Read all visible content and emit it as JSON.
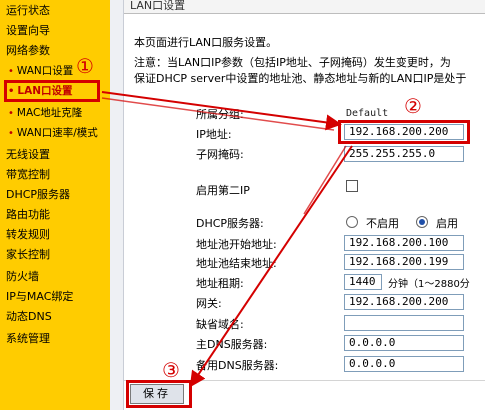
{
  "sidebar": {
    "items": [
      {
        "label": "运行状态"
      },
      {
        "label": "设置向导"
      },
      {
        "label": "网络参数"
      },
      {
        "label": "WAN口设置"
      },
      {
        "label": "LAN口设置"
      },
      {
        "label": "MAC地址克隆"
      },
      {
        "label": "WAN口速率/模式"
      },
      {
        "label": "无线设置"
      },
      {
        "label": "带宽控制"
      },
      {
        "label": "DHCP服务器"
      },
      {
        "label": "路由功能"
      },
      {
        "label": "转发规则"
      },
      {
        "label": "家长控制"
      },
      {
        "label": "防火墙"
      },
      {
        "label": "IP与MAC绑定"
      },
      {
        "label": "动态DNS"
      },
      {
        "label": "系统管理"
      }
    ]
  },
  "panel": {
    "title": "LAN口设置",
    "desc1": "本页面进行LAN口服务设置。",
    "desc2": "注意：当LAN口IP参数（包括IP地址、子网掩码）发生变更时，为",
    "desc3": "保证DHCP server中设置的地址池、静态地址与新的LAN口IP是处于"
  },
  "form": {
    "group_label": "所属分组:",
    "group_value": "Default",
    "ip_label": "IP地址:",
    "ip_value": "192.168.200.200",
    "mask_label": "子网掩码:",
    "mask_value": "255.255.255.0",
    "second_ip_label": "启用第二IP",
    "dhcp_label": "DHCP服务器:",
    "dhcp_off": "不启用",
    "dhcp_on": "启用",
    "pool_start_label": "地址池开始地址:",
    "pool_start_value": "192.168.200.100",
    "pool_end_label": "地址池结束地址:",
    "pool_end_value": "192.168.200.199",
    "lease_label": "地址租期:",
    "lease_value": "1440",
    "lease_unit": "分钟（1～2880分",
    "gateway_label": "网关:",
    "gateway_value": "192.168.200.200",
    "domain_label": "缺省域名:",
    "domain_value": "",
    "dns1_label": "主DNS服务器:",
    "dns1_value": "0.0.0.0",
    "dns2_label": "备用DNS服务器:",
    "dns2_value": "0.0.0.0"
  },
  "actions": {
    "save_label": "保存"
  },
  "annotations": {
    "step1": "①",
    "step2": "②",
    "step3": "③"
  },
  "colors": {
    "sidebar_bg": "#ffcc00",
    "annotation_red": "#d40000",
    "active_nav": "#c00000"
  }
}
